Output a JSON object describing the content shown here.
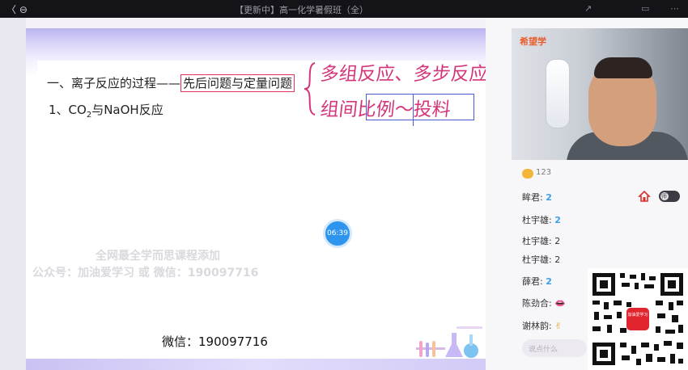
{
  "window": {
    "back_label": "〈 ⊖",
    "title": "【更新中】高一化学暑假班（全）",
    "controls": [
      "↗",
      "▭",
      "⋯"
    ]
  },
  "slide": {
    "heading1_prefix": "一、离子反应的过程——",
    "heading1_boxed": "先后问题与定量问题",
    "heading2_prefix": "1、CO",
    "heading2_sub": "2",
    "heading2_suffix": "与NaOH反应",
    "handwriting_line1": "多组反应、多步反应",
    "handwriting_line2": "组间比例～投料",
    "timer": "06:39",
    "watermark_line1": "全网最全学而思课程添加",
    "watermark_line2": "公众号：加油爱学习 或 微信：190097716",
    "wechat_label": "微信：190097716"
  },
  "video": {
    "brand_logo": "希望学"
  },
  "chat": {
    "likes": "123",
    "messages": [
      {
        "user": "眸君:",
        "content": "2"
      },
      {
        "user": "杜宇雄:",
        "content": "2"
      },
      {
        "user": "杜宇雄:",
        "content": "2"
      },
      {
        "user": "杜宇雄:",
        "content": "2"
      },
      {
        "user": "薛君:",
        "content": "2"
      },
      {
        "user": "陈劲合:",
        "content": "👄"
      },
      {
        "user": "谢林韵:",
        "content": "✌"
      }
    ],
    "teacher_toggle_label": "师",
    "input_placeholder": "说点什么"
  },
  "qr": {
    "badge_text": "加油爱学习"
  },
  "colors": {
    "accent_pink": "#d4357a",
    "box_blue": "#4a5bd6",
    "timer_blue": "#2e95ee",
    "title_bar": "#141418"
  }
}
